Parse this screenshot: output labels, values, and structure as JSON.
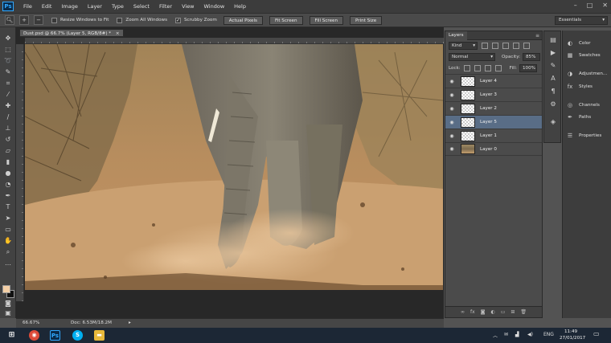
{
  "app": {
    "logo": "Ps"
  },
  "menu": [
    "File",
    "Edit",
    "Image",
    "Layer",
    "Type",
    "Select",
    "Filter",
    "View",
    "Window",
    "Help"
  ],
  "window_controls": {
    "minimize": "–",
    "maximize": "□",
    "close": "✕"
  },
  "options": {
    "resize_windows": "Resize Windows to Fit",
    "zoom_all": "Zoom All Windows",
    "scrubby_zoom": "Scrubby Zoom",
    "actual_pixels": "Actual Pixels",
    "fit_screen": "Fit Screen",
    "fill_screen": "Fill Screen",
    "print_size": "Print Size",
    "workspace": "Essentials"
  },
  "document": {
    "tab_title": "Dust.psd @ 66.7% (Layer 5, RGB/8#) *",
    "close_glyph": "×"
  },
  "status": {
    "zoom": "66.67%",
    "doc_size": "Doc: 6.53M/18.2M",
    "arrow": "▸"
  },
  "layers_panel": {
    "tab": "Layers",
    "menu_glyph": "≡",
    "filter_kind": "Kind",
    "blend_mode": "Normal",
    "opacity_label": "Opacity:",
    "opacity_value": "85%",
    "lock_label": "Lock:",
    "fill_label": "Fill:",
    "fill_value": "100%",
    "layers": [
      {
        "name": "Layer 4",
        "active": false,
        "photo": false
      },
      {
        "name": "Layer 3",
        "active": false,
        "photo": false
      },
      {
        "name": "Layer 2",
        "active": false,
        "photo": false
      },
      {
        "name": "Layer 5",
        "active": true,
        "photo": false
      },
      {
        "name": "Layer 1",
        "active": false,
        "photo": false
      },
      {
        "name": "Layer 0",
        "active": false,
        "photo": true
      }
    ]
  },
  "right_panel": {
    "color": "Color",
    "swatches": "Swatches",
    "adjustments": "Adjustmen...",
    "styles": "Styles",
    "channels": "Channels",
    "paths": "Paths",
    "properties": "Properties"
  },
  "taskbar": {
    "language": "ENG",
    "time": "11:49",
    "date": "27/01/2017"
  }
}
